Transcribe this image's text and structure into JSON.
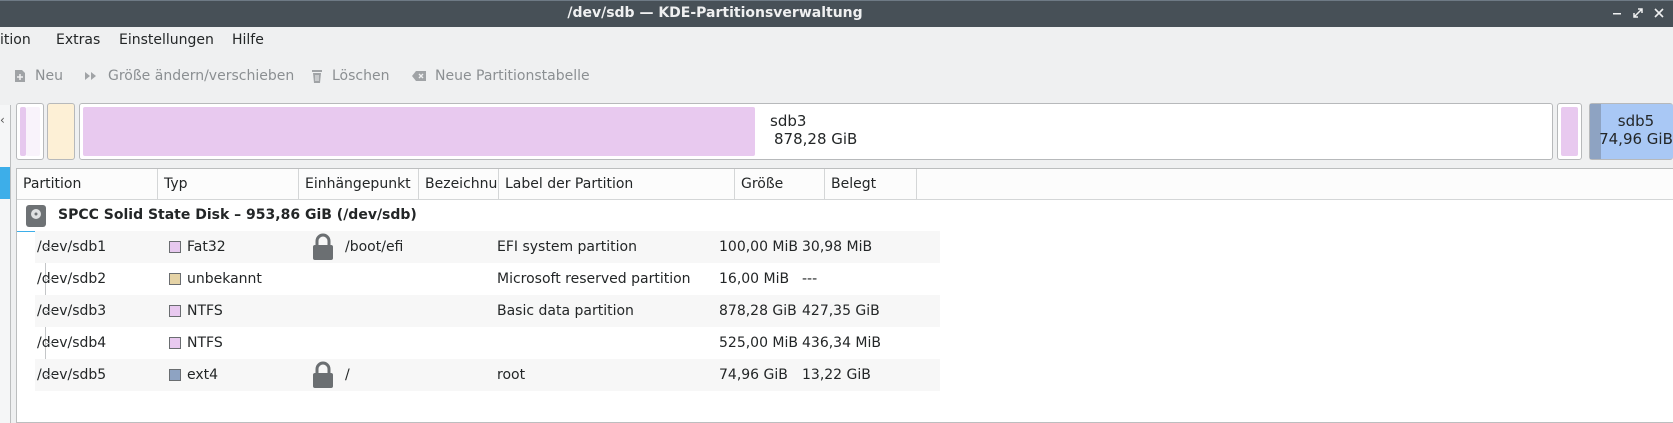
{
  "window": {
    "title": "/dev/sdb — KDE-Partitionsverwaltung",
    "controls": [
      "minimize-icon",
      "maximize-icon",
      "close-icon"
    ]
  },
  "menu": {
    "items": [
      "ition",
      "Extras",
      "Einstellungen",
      "Hilfe"
    ]
  },
  "toolbar": {
    "new": "Neu",
    "resize": "Größe ändern/verschieben",
    "delete": "Löschen",
    "new_table": "Neue Partitionstabelle"
  },
  "partition_bar": {
    "sdb3_name": "sdb3",
    "sdb3_size": "878,28 GiB",
    "sdb3_used_fraction": 0.487,
    "sdb5_name": "sdb5",
    "sdb5_size": "74,96 GiB"
  },
  "table": {
    "headers": [
      "Partition",
      "Typ",
      "Einhängepunkt",
      "Bezeichnu",
      "Label der Partition",
      "Größe",
      "Belegt"
    ],
    "disk": "SPCC Solid State Disk – 953,86 GiB (/dev/sdb)",
    "rows": [
      {
        "partition": "/dev/sdb1",
        "type": "Fat32",
        "color": "#e6c8ee",
        "locked": true,
        "mount": "/boot/efi",
        "label": "EFI system partition",
        "size": "100,00 MiB",
        "used": "30,98 MiB"
      },
      {
        "partition": "/dev/sdb2",
        "type": "unbekannt",
        "color": "#e5d3a6",
        "locked": false,
        "mount": "",
        "label": "Microsoft reserved partition",
        "size": "16,00 MiB",
        "used": "---"
      },
      {
        "partition": "/dev/sdb3",
        "type": "NTFS",
        "color": "#e8c9ef",
        "locked": false,
        "mount": "",
        "label": "Basic data partition",
        "size": "878,28 GiB",
        "used": "427,35 GiB"
      },
      {
        "partition": "/dev/sdb4",
        "type": "NTFS",
        "color": "#e8c9ef",
        "locked": false,
        "mount": "",
        "label": "",
        "size": "525,00 MiB",
        "used": "436,34 MiB"
      },
      {
        "partition": "/dev/sdb5",
        "type": "ext4",
        "color": "#8ea3c2",
        "locked": true,
        "mount": "/",
        "label": "root",
        "size": "74,96 GiB",
        "used": "13,22 GiB"
      }
    ]
  },
  "colors": {
    "accent": "#3daee9",
    "ntfs": "#e8c9ef",
    "ext4": "#a9c8f5",
    "unknown": "#fdf0d6"
  }
}
